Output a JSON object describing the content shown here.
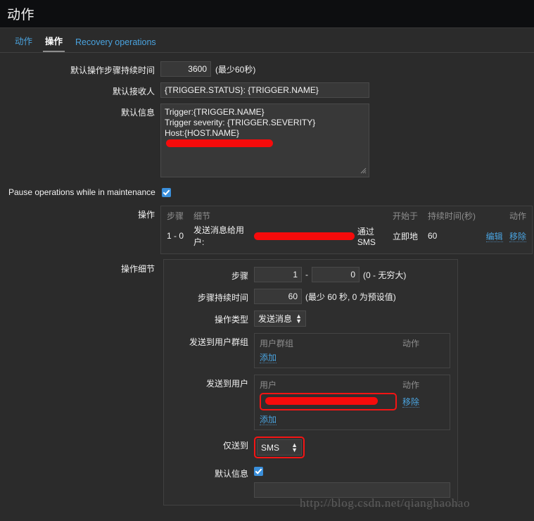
{
  "header": {
    "title": "动作"
  },
  "tabs": [
    {
      "label": "动作",
      "active": false
    },
    {
      "label": "操作",
      "active": true
    },
    {
      "label": "Recovery operations",
      "active": false
    }
  ],
  "form": {
    "default_step_duration": {
      "label": "默认操作步骤持续时间",
      "value": "3600",
      "hint": "(最少60秒)"
    },
    "default_subject": {
      "label": "默认接收人",
      "value": "{TRIGGER.STATUS}: {TRIGGER.NAME}"
    },
    "default_message": {
      "label": "默认信息",
      "value": "Trigger:{TRIGGER.NAME}\nTrigger severity: {TRIGGER.SEVERITY}\nHost:{HOST.NAME}\n"
    },
    "pause_operations": {
      "label": "Pause operations while in maintenance",
      "checked": true
    }
  },
  "operations": {
    "label": "操作",
    "columns": {
      "step": "步骤",
      "details": "细节",
      "start_in": "开始于",
      "duration": "持续时间(秒)",
      "action": "动作"
    },
    "rows": [
      {
        "step": "1 - 0",
        "detail_prefix": "发送消息给用户:",
        "detail_redacted": true,
        "detail_suffix": "通过 SMS",
        "start_in": "立即地",
        "duration": "60",
        "edit_label": "编辑",
        "remove_label": "移除"
      }
    ]
  },
  "operation_details": {
    "label": "操作细节",
    "steps": {
      "label": "步骤",
      "from": "1",
      "separator": "-",
      "to": "0",
      "hint": "(0 - 无穷大)"
    },
    "step_duration": {
      "label": "步骤持续时间",
      "value": "60",
      "hint": "(最少 60 秒, 0 为预设值)"
    },
    "operation_type": {
      "label": "操作类型",
      "value": "发送消息",
      "options": [
        "发送消息"
      ]
    },
    "send_to_user_groups": {
      "label": "发送到用户群组",
      "col_name": "用户群组",
      "col_action": "动作",
      "rows": [],
      "add_label": "添加"
    },
    "send_to_users": {
      "label": "发送到用户",
      "col_name": "用户",
      "col_action": "动作",
      "rows": [
        {
          "name_redacted": true,
          "remove_label": "移除",
          "highlighted": true
        }
      ],
      "add_label": "添加"
    },
    "send_only_to": {
      "label": "仅送到",
      "value": "SMS",
      "options": [
        "SMS"
      ],
      "highlighted": true
    },
    "default_message": {
      "label": "默认信息",
      "checked": true
    }
  },
  "watermark": {
    "text": "http://blog.csdn.net/qianghaohao"
  },
  "colors": {
    "accent_link": "#4aa3df",
    "checkbox": "#3a8fdb",
    "highlight_box": "#f41414",
    "redaction": "#f60b0b",
    "header_bg": "#0d0e10",
    "body_bg": "#2b2b2b"
  }
}
